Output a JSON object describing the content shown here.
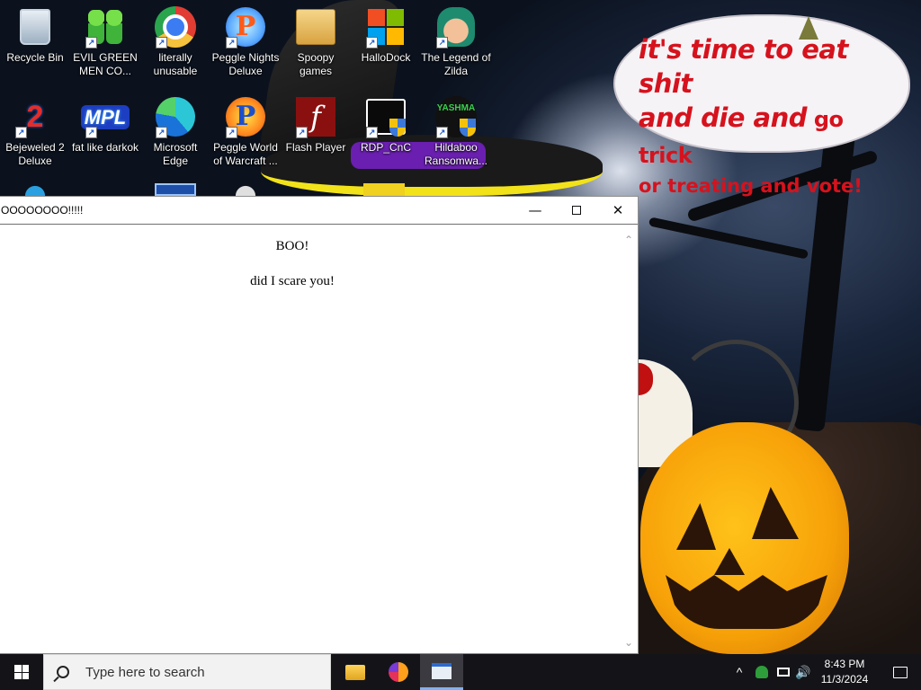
{
  "desktop": {
    "icons": [
      {
        "label": "Recycle Bin",
        "icon": "recycle-bin-icon"
      },
      {
        "label": "EVIL GREEN MEN CO...",
        "icon": "green-men-icon"
      },
      {
        "label": "literally unusable",
        "icon": "chrome-icon"
      },
      {
        "label": "Peggle Nights Deluxe",
        "icon": "peggle-nights-icon"
      },
      {
        "label": "Spoopy games",
        "icon": "folder-icon"
      },
      {
        "label": "HalloDock",
        "icon": "windows-logo-icon"
      },
      {
        "label": "The Legend of Zilda",
        "icon": "zilda-icon"
      },
      {
        "label": "Bejeweled 2 Deluxe",
        "icon": "bejeweled-icon"
      },
      {
        "label": "fat like darkok",
        "icon": "mpl-icon"
      },
      {
        "label": "Microsoft Edge",
        "icon": "edge-icon"
      },
      {
        "label": "Peggle World of Warcraft ...",
        "icon": "peggle-wow-icon"
      },
      {
        "label": "Flash Player",
        "icon": "flash-icon"
      },
      {
        "label": "RDP_CnC",
        "icon": "rdp-icon"
      },
      {
        "label": "Hildaboo Ransomwa...",
        "icon": "yashma-icon"
      }
    ],
    "peggle_letter": "P",
    "bejeweled_glyph": "2",
    "mpl_text": "MPL",
    "flash_glyph": "f",
    "yashma_text": "YASHMA",
    "shortcut_glyph": "↗"
  },
  "wallpaper": {
    "bubble_line1": "it's time to eat shit",
    "bubble_line2a": "and die and",
    "bubble_line2b": " go trick",
    "bubble_line3": "or treating and vote!",
    "bubble_color": "#d6121d"
  },
  "window": {
    "title": "OOOOOOOO!!!!!",
    "minimize_glyph": "—",
    "close_glyph": "✕",
    "heading": "BOO!",
    "message": "did I scare you!",
    "scroll_up_glyph": "⌃",
    "scroll_down_glyph": "⌄"
  },
  "taskbar": {
    "search_placeholder": "Type here to search",
    "apps": [
      {
        "name": "File Explorer",
        "icon": "file-explorer-icon"
      },
      {
        "name": "Firefox",
        "icon": "firefox-icon"
      },
      {
        "name": "Active window",
        "icon": "window-app-icon"
      }
    ],
    "tray_chevron": "^",
    "volume_glyph": "🔊",
    "time": "8:43 PM",
    "date": "11/3/2024"
  }
}
